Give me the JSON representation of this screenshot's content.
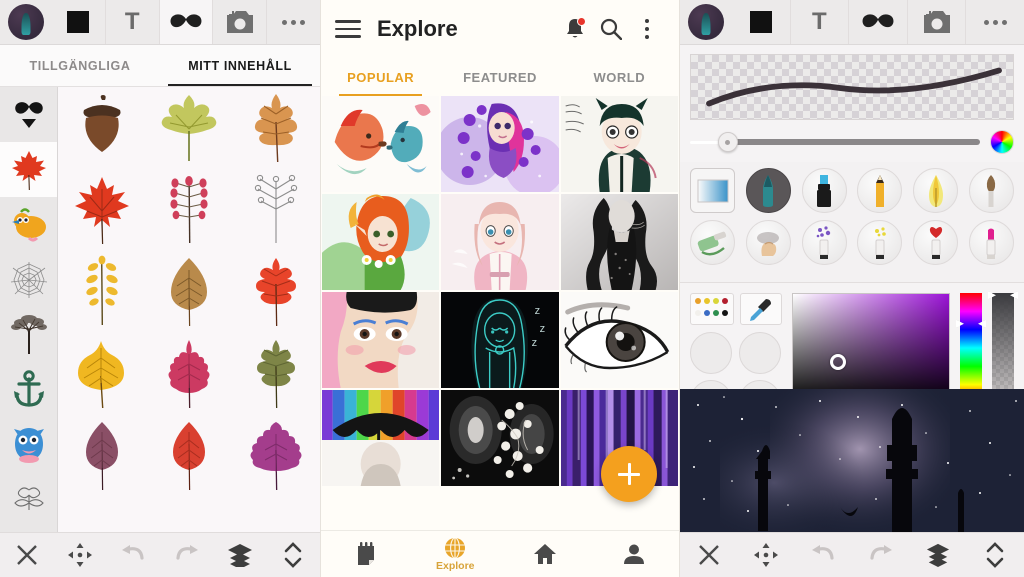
{
  "panel_left": {
    "name": "sticker-picker",
    "toolbar": {
      "avatar_alt": "user-avatar",
      "items": [
        {
          "icon": "color-square-icon",
          "label": "Color"
        },
        {
          "icon": "text-icon",
          "label": "T"
        },
        {
          "icon": "mustache-sticker-icon",
          "label": "Stickers"
        },
        {
          "icon": "add-photo-icon",
          "label": "Add photo"
        },
        {
          "icon": "more-options-icon",
          "label": "More"
        }
      ]
    },
    "tabs": [
      {
        "label": "TILLGÄNGLIGA",
        "active": false
      },
      {
        "label": "MITT INNEHÅLL",
        "active": true
      }
    ],
    "categories": [
      {
        "name": "mustache-category",
        "selected": false,
        "has_dropdown": true
      },
      {
        "name": "maple-leaf-category",
        "selected": true
      },
      {
        "name": "bird-category",
        "selected": false
      },
      {
        "name": "spiderweb-category",
        "selected": false
      },
      {
        "name": "tree-category",
        "selected": false
      },
      {
        "name": "anchor-category",
        "selected": false
      },
      {
        "name": "monster-category",
        "selected": false
      },
      {
        "name": "ornament-category",
        "selected": false
      }
    ],
    "stickers": [
      {
        "name": "acorn-sticker",
        "kind": "acorn",
        "color": "#6b4226"
      },
      {
        "name": "maple-pale-leaf-sticker",
        "kind": "lobed",
        "color": "#c9cc62"
      },
      {
        "name": "orange-oak-leaf-sticker",
        "kind": "oak",
        "color": "#d59549"
      },
      {
        "name": "red-maple-sticker",
        "kind": "maple",
        "color": "#e03b24"
      },
      {
        "name": "berry-branch-sticker",
        "kind": "berry",
        "color": "#d6465b"
      },
      {
        "name": "outline-branch-sticker",
        "kind": "outline",
        "color": "#9a9a9a"
      },
      {
        "name": "yellow-fern-sticker",
        "kind": "fern",
        "color": "#edb92e"
      },
      {
        "name": "brown-leaf-sticker",
        "kind": "simple",
        "color": "#b98a4b"
      },
      {
        "name": "red-oak-leaf-sticker",
        "kind": "oak",
        "color": "#e8442a"
      },
      {
        "name": "yellow-aspen-sticker",
        "kind": "aspen",
        "color": "#f0b721"
      },
      {
        "name": "pink-serrated-leaf-sticker",
        "kind": "serrated",
        "color": "#cc3a62"
      },
      {
        "name": "olive-oak-leaf-sticker",
        "kind": "oak",
        "color": "#7e8547"
      },
      {
        "name": "purple-leaf-sticker",
        "kind": "simple",
        "color": "#8a4f66"
      },
      {
        "name": "red-simple-leaf-sticker",
        "kind": "simple",
        "color": "#d94030"
      },
      {
        "name": "magenta-scalloped-leaf-sticker",
        "kind": "scalloped",
        "color": "#a43d8c"
      }
    ],
    "bottom_toolbar": [
      {
        "name": "close-button",
        "icon": "close-icon"
      },
      {
        "name": "move-button",
        "icon": "move-arrows-icon"
      },
      {
        "name": "undo-button",
        "icon": "undo-icon",
        "disabled": true
      },
      {
        "name": "redo-button",
        "icon": "redo-icon",
        "disabled": true
      },
      {
        "name": "layers-button",
        "icon": "layers-icon"
      },
      {
        "name": "reorder-button",
        "icon": "chevron-up-down-icon"
      }
    ]
  },
  "panel_center": {
    "name": "explore-feed",
    "header": {
      "menu_icon": "hamburger-menu-icon",
      "title": "Explore",
      "notifications_icon": "bell-icon",
      "has_notification": true,
      "search_icon": "search-icon",
      "overflow_icon": "kebab-menu-icon"
    },
    "tabs": [
      {
        "label": "POPULAR",
        "active": true
      },
      {
        "label": "FEATURED",
        "active": false
      },
      {
        "label": "WORLD",
        "active": false
      }
    ],
    "accent_color": "#e8a020",
    "artworks": [
      {
        "name": "artwork-watercolor-foxes",
        "style": "foxes"
      },
      {
        "name": "artwork-purple-flower-girl",
        "style": "purplegirl"
      },
      {
        "name": "artwork-green-haired-anime",
        "style": "greenanime"
      },
      {
        "name": "artwork-fire-hair-elf",
        "style": "fireelf"
      },
      {
        "name": "artwork-pink-hoodie-girl",
        "style": "pinkgirl"
      },
      {
        "name": "artwork-bw-tattoo-portrait",
        "style": "bwportrait"
      },
      {
        "name": "artwork-pastel-pop-face",
        "style": "popface"
      },
      {
        "name": "artwork-neon-sleeping-girl",
        "style": "neongirl"
      },
      {
        "name": "artwork-pencil-eye-study",
        "style": "eye"
      },
      {
        "name": "artwork-rainbow-umbrella",
        "style": "umbrella"
      },
      {
        "name": "artwork-bw-floral-dark",
        "style": "floraldark"
      },
      {
        "name": "artwork-purple-drips",
        "style": "purpledrips"
      }
    ],
    "fab": {
      "name": "create-new-button",
      "icon": "plus-icon",
      "color": "#f4a01e"
    },
    "bottom_nav": [
      {
        "name": "nav-notes",
        "icon": "notepad-icon",
        "label": "",
        "active": false
      },
      {
        "name": "nav-explore",
        "icon": "globe-icon",
        "label": "Explore",
        "active": true
      },
      {
        "name": "nav-home",
        "icon": "home-icon",
        "label": "",
        "active": false
      },
      {
        "name": "nav-profile",
        "icon": "person-icon",
        "label": "",
        "active": false
      }
    ]
  },
  "panel_right": {
    "name": "brush-color-editor",
    "toolbar": {
      "avatar_alt": "user-avatar",
      "items": [
        {
          "icon": "color-square-icon",
          "label": "Color"
        },
        {
          "icon": "text-icon",
          "label": "T"
        },
        {
          "icon": "mustache-sticker-icon",
          "label": "Stickers"
        },
        {
          "icon": "add-photo-icon",
          "label": "Add photo"
        },
        {
          "icon": "more-options-icon",
          "label": "More"
        }
      ]
    },
    "stroke_preview": {
      "name": "brush-stroke-preview",
      "stroke_color": "#3a3138"
    },
    "size_slider": {
      "name": "brush-size-slider",
      "value_percent": 13
    },
    "color_wheel_button": {
      "name": "color-wheel-button",
      "icon": "color-wheel-icon"
    },
    "brushes_row1": [
      {
        "name": "brush-gradient-tool",
        "icon": "gradient-square-icon",
        "selected": true
      },
      {
        "name": "brush-ink-pen",
        "icon": "ink-pen-icon",
        "selected": false
      },
      {
        "name": "brush-marker",
        "icon": "marker-icon",
        "selected": false
      },
      {
        "name": "brush-pencil",
        "icon": "pencil-icon",
        "selected": false
      },
      {
        "name": "brush-calligraphy",
        "icon": "calligraphy-nib-icon",
        "selected": false
      },
      {
        "name": "brush-fan",
        "icon": "fan-brush-icon",
        "selected": false
      }
    ],
    "brushes_row2": [
      {
        "name": "brush-paint-roller",
        "icon": "paint-roller-icon",
        "selected": false
      },
      {
        "name": "brush-smudge",
        "icon": "smudge-finger-icon",
        "selected": false
      },
      {
        "name": "brush-spray-dots",
        "icon": "spray-dots-icon",
        "selected": false
      },
      {
        "name": "brush-spray-sparkle",
        "icon": "spray-sparkle-icon",
        "selected": false
      },
      {
        "name": "brush-heart-stamp",
        "icon": "heart-stamp-icon",
        "selected": false
      },
      {
        "name": "brush-lipstick",
        "icon": "lipstick-icon",
        "selected": false
      }
    ],
    "color_picker": {
      "palette_button": {
        "name": "palette-button",
        "icon": "palette-icon"
      },
      "eyedropper_button": {
        "name": "eyedropper-button",
        "icon": "eyedropper-icon"
      },
      "palette_swatches": [
        "#e8a02a",
        "#e8c52a",
        "#d9d63a",
        "#b31f2e",
        "#f2f0ec",
        "#3b6cc4",
        "#2e8f4f",
        "#141414"
      ],
      "saved_slots": [
        {
          "name": "saved-color-slot-1",
          "color": "#ededed"
        },
        {
          "name": "saved-color-slot-2",
          "color": "#ededed"
        },
        {
          "name": "saved-color-slot-3",
          "color": "#ededed"
        },
        {
          "name": "saved-color-slot-4",
          "color": "#ededed"
        }
      ],
      "sv_field": {
        "name": "saturation-value-field",
        "hue_color": "#9b13d6",
        "cursor_x_percent": 29,
        "cursor_y_percent": 63
      },
      "hue_slider": {
        "name": "hue-slider",
        "position_percent": 28
      },
      "alpha_slider": {
        "name": "alpha-slider",
        "position_percent": 2
      }
    },
    "canvas": {
      "name": "drawing-canvas",
      "description": "nebula-sky-with-silhouettes"
    },
    "bottom_toolbar": [
      {
        "name": "close-button",
        "icon": "close-icon"
      },
      {
        "name": "move-button",
        "icon": "move-arrows-icon"
      },
      {
        "name": "undo-button",
        "icon": "undo-icon",
        "disabled": true
      },
      {
        "name": "redo-button",
        "icon": "redo-icon",
        "disabled": true
      },
      {
        "name": "layers-button",
        "icon": "layers-icon"
      },
      {
        "name": "reorder-button",
        "icon": "chevron-up-down-icon"
      }
    ]
  }
}
